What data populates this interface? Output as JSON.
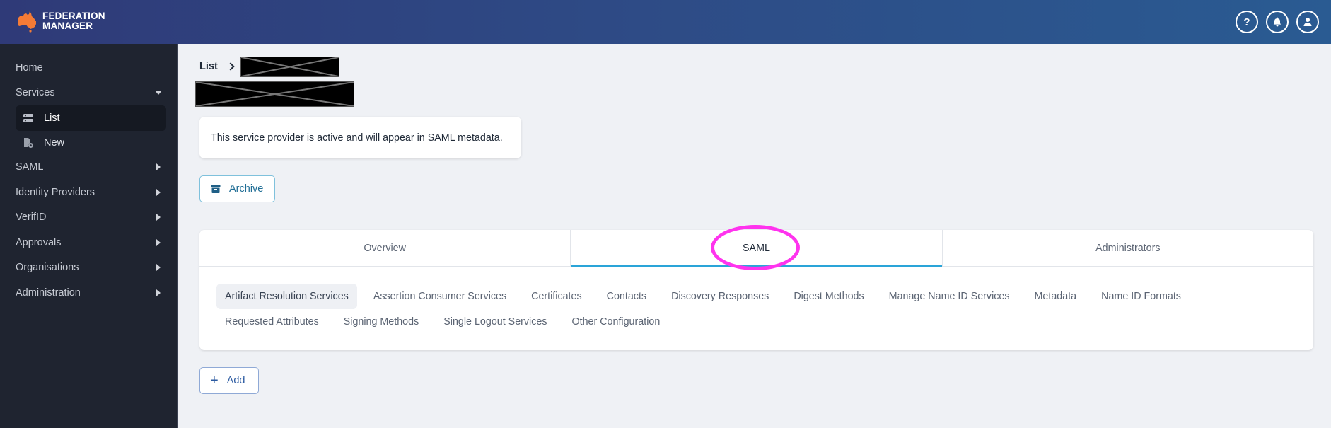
{
  "header": {
    "brand_line1": "FEDERATION",
    "brand_line2": "MANAGER",
    "brand_color": "#f47b36",
    "icons": [
      "help-icon",
      "bell-icon",
      "user-icon"
    ],
    "help_glyph": "?"
  },
  "sidebar": {
    "items": [
      {
        "label": "Home",
        "expandable": false
      },
      {
        "label": "Services",
        "expandable": true,
        "expanded": true,
        "children": [
          {
            "label": "List",
            "icon": "server-icon",
            "active": true
          },
          {
            "label": "New",
            "icon": "new-document-icon",
            "active": false
          }
        ]
      },
      {
        "label": "SAML",
        "expandable": true,
        "expanded": false
      },
      {
        "label": "Identity Providers",
        "expandable": true,
        "expanded": false
      },
      {
        "label": "VerifID",
        "expandable": true,
        "expanded": false
      },
      {
        "label": "Approvals",
        "expandable": true,
        "expanded": false
      },
      {
        "label": "Organisations",
        "expandable": true,
        "expanded": false
      },
      {
        "label": "Administration",
        "expandable": true,
        "expanded": false
      }
    ]
  },
  "breadcrumb": {
    "root": "List",
    "current": "[redacted]"
  },
  "page_title": "[redacted]",
  "notice": "This service provider is active and will appear in SAML metadata.",
  "buttons": {
    "archive": "Archive",
    "add": "Add",
    "add_glyph": "+"
  },
  "tabs": [
    {
      "label": "Overview",
      "active": false
    },
    {
      "label": "SAML",
      "active": true
    },
    {
      "label": "Administrators",
      "active": false
    }
  ],
  "subtabs": [
    {
      "label": "Artifact Resolution Services",
      "active": true
    },
    {
      "label": "Assertion Consumer Services",
      "active": false
    },
    {
      "label": "Certificates",
      "active": false
    },
    {
      "label": "Contacts",
      "active": false
    },
    {
      "label": "Discovery Responses",
      "active": false
    },
    {
      "label": "Digest Methods",
      "active": false
    },
    {
      "label": "Manage Name ID Services",
      "active": false
    },
    {
      "label": "Metadata",
      "active": false
    },
    {
      "label": "Name ID Formats",
      "active": false
    },
    {
      "label": "Requested Attributes",
      "active": false
    },
    {
      "label": "Signing Methods",
      "active": false
    },
    {
      "label": "Single Logout Services",
      "active": false
    },
    {
      "label": "Other Configuration",
      "active": false
    }
  ],
  "colors": {
    "accent": "#2aa4d8",
    "annotation": "#ff33ee",
    "sidebar_bg": "#1f2430",
    "header_start": "#2f3a78",
    "header_end": "#2a5b92"
  }
}
